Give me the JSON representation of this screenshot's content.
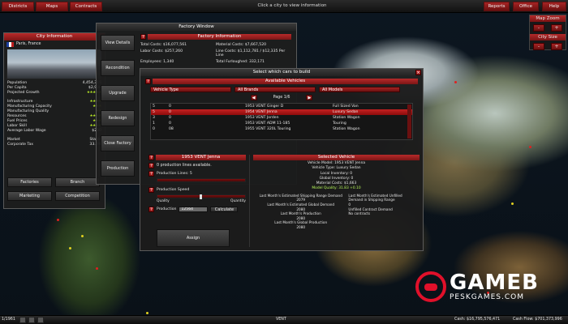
{
  "topbar": {
    "left_buttons": [
      "Districts",
      "Maps",
      "Contracts"
    ],
    "hint": "Click a city to view information",
    "right_buttons": [
      "Reports",
      "Office",
      "Help"
    ]
  },
  "map_zoom": {
    "title": "Map Zoom",
    "city_size_label": "City Size",
    "minus": "-",
    "plus": "+"
  },
  "city_info": {
    "title": "City Information",
    "city_name": "Paris, France",
    "rows": [
      {
        "label": "Population",
        "value": "4,454,315"
      },
      {
        "label": "Per Capita",
        "value": "$2,908"
      },
      {
        "label": "Projected Growth",
        "value": "★★★★★"
      },
      {
        "label": "Infrastructure",
        "value": "★★★★"
      },
      {
        "label": "Manufacturing Capacity",
        "value": "★★★"
      },
      {
        "label": "Manufacturing Quality",
        "value": "★★"
      },
      {
        "label": "Resources",
        "value": "★★★★"
      },
      {
        "label": "Fuel Prices",
        "value": "★★★"
      },
      {
        "label": "Labor Skill",
        "value": "★★★★"
      },
      {
        "label": "Average Labor Wage",
        "value": "$230"
      }
    ],
    "market_label": "Market",
    "market_value": "Stable",
    "tax_label": "Corporate Tax",
    "tax_value": "33.0%",
    "buttons": [
      "Factories",
      "Branch",
      "Marketing",
      "Competition"
    ]
  },
  "factory_window": {
    "title": "Factory Window",
    "side_buttons": [
      "View Details",
      "Recondition",
      "Upgrade",
      "Redesign",
      "Close Factory",
      "Production"
    ],
    "info_title": "Factory Information",
    "total_costs_label": "Total Costs:",
    "total_costs": "$16,077,561",
    "material_costs_label": "Material Costs:",
    "material_costs": "$7,667,520",
    "labor_costs_label": "Labor Costs:",
    "labor_costs": "$257,260",
    "line_costs_label": "Line Costs:",
    "line_costs": "$1,112,781 / $12,335 Per Line",
    "employees_label": "Employees:",
    "employees": "1,340",
    "total_furloughed_label": "Total Furloughed:",
    "total_furloughed": "332,171"
  },
  "select_cars": {
    "title": "Select which cars to build",
    "available_title": "Available Vehicles",
    "filters": [
      "Vehicle Type",
      "All Brands",
      "All Models"
    ],
    "page_label": "Page 1/6",
    "rows": [
      {
        "a": "5",
        "b": "0",
        "name": "1953 VENT Ginger D",
        "type": "Full Sized Van"
      },
      {
        "a": "5",
        "b": "0",
        "name": "1954 VENT Jenna",
        "type": "Luxury Sedan"
      },
      {
        "a": "3",
        "b": "0",
        "name": "1953 VENT Jorden",
        "type": "Station Wagon"
      },
      {
        "a": "1",
        "b": "0",
        "name": "1953 VENT ADM 11-185",
        "type": "Touring"
      },
      {
        "a": "0",
        "b": "08",
        "name": "1955 VENT 320L Touring",
        "type": "Station Wagon"
      }
    ],
    "selected_row": 1,
    "left_title": "1953 VENT Jenna",
    "production_lines_text": "0 production lines available.",
    "production_lines_label": "Production Lines: 5",
    "production_speed_label": "Production Speed",
    "quality_label": "Quality",
    "quantity_label": "Quantity",
    "production_label": "Production",
    "production_value": "12564",
    "calculate_label": "Calculate",
    "assign_label": "Assign",
    "selected_title": "Selected Vehicle",
    "details": [
      "Vehicle Model: 1953 VENT Jenna",
      "Vehicle Type: Luxury Sedan",
      "Local Inventory: 0",
      "Global Inventory: 0",
      "Material Costs: $1,663",
      "Model Quality: 31.83 +0.10"
    ],
    "demand_left": [
      "Last Month's Estimated Shipping Range Demand",
      "2079",
      "Last Month's Estimated Global Demand",
      "2080",
      "Last Month's Production",
      "2080",
      "Last Month's Global Production",
      "2080"
    ],
    "demand_right": [
      "Last Month's Estimated Unfilled",
      "Demand in Shipping Range",
      "0",
      "Unfilled Contract Demand",
      "No contracts"
    ]
  },
  "bottombar": {
    "date": "1/1961",
    "center": "VENT",
    "cash_label": "Cash:",
    "cash": "$16,795,576,471",
    "cashflow_label": "Cash Flow:",
    "cashflow": "$701,373,996"
  },
  "watermark": {
    "brand": "GAMEB",
    "site": "PESKGAMES.COM"
  }
}
